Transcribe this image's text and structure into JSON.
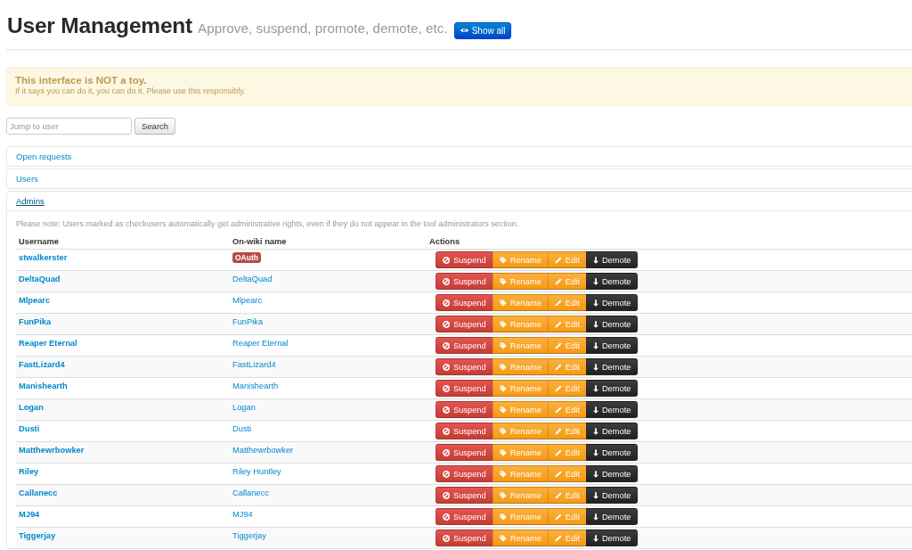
{
  "header": {
    "title": "User Management",
    "subtitle": "Approve, suspend, promote, demote, etc.",
    "show_all_button": "Show all"
  },
  "alert": {
    "heading": "This interface is NOT a toy.",
    "text": "If it says you can do it, you can do it. Please use this responsibly."
  },
  "search": {
    "placeholder": "Jump to user",
    "button": "Search"
  },
  "sections": [
    {
      "title": "Open requests",
      "expanded": false
    },
    {
      "title": "Users",
      "expanded": false
    },
    {
      "title": "Admins",
      "expanded": true,
      "note": "Please note: Users marked as checkusers automatically get administrative rights, even if they do not appear in the tool administrators section.",
      "table": {
        "columns": [
          "Username",
          "On-wiki name",
          "Actions"
        ],
        "rows": [
          {
            "username": "stwalkerster",
            "onwiki": {
              "kind": "badge",
              "text": "OAuth"
            },
            "actions": [
              {
                "kind": "suspend",
                "label": "Suspend"
              },
              {
                "kind": "rename",
                "label": "Rename"
              },
              {
                "kind": "edit",
                "label": "Edit"
              },
              {
                "kind": "demote",
                "label": "Demote"
              }
            ]
          },
          {
            "username": "DeltaQuad",
            "onwiki": {
              "kind": "link",
              "text": "DeltaQuad"
            },
            "actions": [
              {
                "kind": "suspend",
                "label": "Suspend"
              },
              {
                "kind": "rename",
                "label": "Rename"
              },
              {
                "kind": "edit",
                "label": "Edit"
              },
              {
                "kind": "demote",
                "label": "Demote"
              }
            ]
          },
          {
            "username": "Mlpearc",
            "onwiki": {
              "kind": "link",
              "text": "Mlpearc"
            },
            "actions": [
              {
                "kind": "suspend",
                "label": "Suspend"
              },
              {
                "kind": "rename",
                "label": "Rename"
              },
              {
                "kind": "edit",
                "label": "Edit"
              },
              {
                "kind": "demote",
                "label": "Demote"
              }
            ]
          },
          {
            "username": "FunPika",
            "onwiki": {
              "kind": "link",
              "text": "FunPika"
            },
            "actions": [
              {
                "kind": "suspend",
                "label": "Suspend"
              },
              {
                "kind": "rename",
                "label": "Rename"
              },
              {
                "kind": "edit",
                "label": "Edit"
              },
              {
                "kind": "demote",
                "label": "Demote"
              }
            ]
          },
          {
            "username": "Reaper Eternal",
            "onwiki": {
              "kind": "link",
              "text": "Reaper Eternal"
            },
            "actions": [
              {
                "kind": "suspend",
                "label": "Suspend"
              },
              {
                "kind": "rename",
                "label": "Rename"
              },
              {
                "kind": "edit",
                "label": "Edit"
              },
              {
                "kind": "demote",
                "label": "Demote"
              }
            ]
          },
          {
            "username": "FastLizard4",
            "onwiki": {
              "kind": "link",
              "text": "FastLizard4"
            },
            "actions": [
              {
                "kind": "suspend",
                "label": "Suspend"
              },
              {
                "kind": "rename",
                "label": "Rename"
              },
              {
                "kind": "edit",
                "label": "Edit"
              },
              {
                "kind": "demote",
                "label": "Demote"
              }
            ]
          },
          {
            "username": "Manishearth",
            "onwiki": {
              "kind": "link",
              "text": "Manishearth"
            },
            "actions": [
              {
                "kind": "suspend",
                "label": "Suspend"
              },
              {
                "kind": "rename",
                "label": "Rename"
              },
              {
                "kind": "edit",
                "label": "Edit"
              },
              {
                "kind": "demote",
                "label": "Demote"
              }
            ]
          },
          {
            "username": "Logan",
            "onwiki": {
              "kind": "link",
              "text": "Logan"
            },
            "actions": [
              {
                "kind": "suspend",
                "label": "Suspend"
              },
              {
                "kind": "rename",
                "label": "Rename"
              },
              {
                "kind": "edit",
                "label": "Edit"
              },
              {
                "kind": "demote",
                "label": "Demote"
              }
            ]
          },
          {
            "username": "Dusti",
            "onwiki": {
              "kind": "link",
              "text": "Dusti"
            },
            "actions": [
              {
                "kind": "suspend",
                "label": "Suspend"
              },
              {
                "kind": "rename",
                "label": "Rename"
              },
              {
                "kind": "edit",
                "label": "Edit"
              },
              {
                "kind": "demote",
                "label": "Demote"
              }
            ]
          },
          {
            "username": "Matthewrbowker",
            "onwiki": {
              "kind": "link",
              "text": "Matthewrbowker"
            },
            "actions": [
              {
                "kind": "suspend",
                "label": "Suspend"
              },
              {
                "kind": "rename",
                "label": "Rename"
              },
              {
                "kind": "edit",
                "label": "Edit"
              },
              {
                "kind": "demote",
                "label": "Demote"
              }
            ]
          },
          {
            "username": "Riley",
            "onwiki": {
              "kind": "link",
              "text": "Riley Huntley"
            },
            "actions": [
              {
                "kind": "suspend",
                "label": "Suspend"
              },
              {
                "kind": "rename",
                "label": "Rename"
              },
              {
                "kind": "edit",
                "label": "Edit"
              },
              {
                "kind": "demote",
                "label": "Demote"
              }
            ]
          },
          {
            "username": "Callanecc",
            "onwiki": {
              "kind": "link",
              "text": "Callanecc"
            },
            "actions": [
              {
                "kind": "suspend",
                "label": "Suspend"
              },
              {
                "kind": "rename",
                "label": "Rename"
              },
              {
                "kind": "edit",
                "label": "Edit"
              },
              {
                "kind": "demote",
                "label": "Demote"
              }
            ]
          },
          {
            "username": "MJ94",
            "onwiki": {
              "kind": "link",
              "text": "MJ94"
            },
            "actions": [
              {
                "kind": "suspend",
                "label": "Suspend"
              },
              {
                "kind": "rename",
                "label": "Rename"
              },
              {
                "kind": "edit",
                "label": "Edit"
              },
              {
                "kind": "demote",
                "label": "Demote"
              }
            ]
          },
          {
            "username": "Tiggerjay",
            "onwiki": {
              "kind": "link",
              "text": "Tiggerjay"
            },
            "actions": [
              {
                "kind": "suspend",
                "label": "Suspend"
              },
              {
                "kind": "rename",
                "label": "Rename"
              },
              {
                "kind": "edit",
                "label": "Edit"
              },
              {
                "kind": "demote",
                "label": "Demote"
              }
            ]
          }
        ]
      }
    }
  ]
}
